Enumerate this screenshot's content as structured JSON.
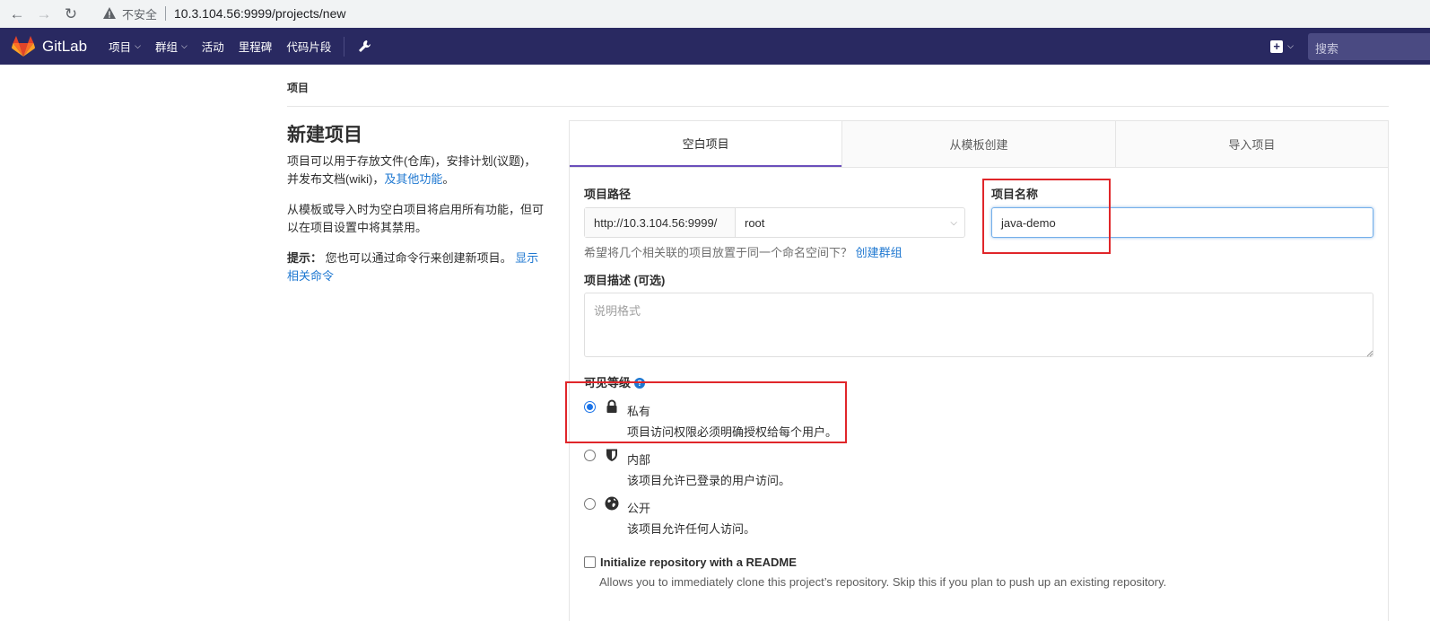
{
  "browser": {
    "insecure_label": "不安全",
    "url": "10.3.104.56:9999/projects/new"
  },
  "header": {
    "brand": "GitLab",
    "nav": [
      {
        "label": "项目",
        "caret": true
      },
      {
        "label": "群组",
        "caret": true
      },
      {
        "label": "活动",
        "caret": false
      },
      {
        "label": "里程碑",
        "caret": false
      },
      {
        "label": "代码片段",
        "caret": false
      }
    ],
    "search_placeholder": "搜索",
    "colors": {
      "header_bg": "#292961",
      "accent": "#6b4fbb",
      "link": "#1f78d1"
    }
  },
  "breadcrumb": "项目",
  "sidebar": {
    "title": "新建项目",
    "para1": "项目可以用于存放文件(仓库)，安排计划(议题)，并发布文档(wiki)，",
    "para1_link": "及其他功能",
    "para1_end": "。",
    "para2": "从模板或导入时为空白项目将启用所有功能，但可以在项目设置中将其禁用。",
    "tip_label": "提示：",
    "tip_text": "您也可以通过命令行来创建新项目。",
    "tip_link": "显示相关命令"
  },
  "tabs": [
    "空白项目",
    "从模板创建",
    "导入项目"
  ],
  "form": {
    "path_label": "项目路径",
    "path_prefix": "http://10.3.104.56:9999/",
    "namespace": "root",
    "hint_text": "希望将几个相关联的项目放置于同一个命名空间下？",
    "hint_link": "创建群组",
    "name_label": "项目名称",
    "name_value": "java-demo",
    "desc_label": "项目描述 (可选)",
    "desc_placeholder": "说明格式",
    "visibility_label": "可见等级",
    "visibility": [
      {
        "title": "私有",
        "desc": "项目访问权限必须明确授权给每个用户。",
        "icon": "lock-icon",
        "checked": true
      },
      {
        "title": "内部",
        "desc": "该项目允许已登录的用户访问。",
        "icon": "shield-icon",
        "checked": false
      },
      {
        "title": "公开",
        "desc": "该项目允许任何人访问。",
        "icon": "globe-icon",
        "checked": false
      }
    ],
    "readme_label": "Initialize repository with a README",
    "readme_desc": "Allows you to immediately clone this project’s repository. Skip this if you plan to push up an existing repository."
  },
  "annotation_color": "#e0262a"
}
